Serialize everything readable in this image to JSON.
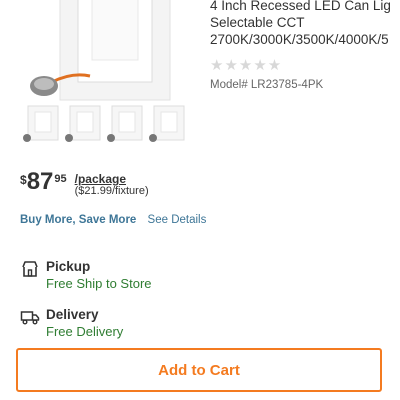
{
  "product": {
    "title_lines": [
      "4 Inch Recessed LED Can Lig",
      "Selectable CCT",
      "2700K/3000K/3500K/4000K/5"
    ],
    "rating_stars": "★★★★★",
    "model": "Model# LR23785-4PK"
  },
  "pricing": {
    "dollar_sign": "$",
    "price_main": "87",
    "price_cents": "95",
    "unit": "/package",
    "per_fixture": "($21.99/fixture)"
  },
  "promo": {
    "label": "Buy More, Save More",
    "link": "See Details"
  },
  "fulfillment": {
    "pickup": {
      "label": "Pickup",
      "detail": "Free Ship to Store",
      "icon": "store-icon"
    },
    "delivery": {
      "label": "Delivery",
      "detail": "Free Delivery",
      "icon": "truck-icon"
    }
  },
  "cta": {
    "add_to_cart": "Add to Cart"
  },
  "colors": {
    "accent": "#f47b20",
    "link": "#3e7697",
    "success": "#2f7d32"
  }
}
